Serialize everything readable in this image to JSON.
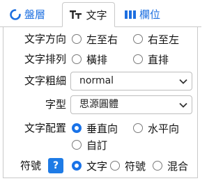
{
  "tabs": [
    {
      "label": "盤層",
      "icon": "circle-notch-icon",
      "active": false
    },
    {
      "label": "文字",
      "icon": "text-size-icon",
      "active": true
    },
    {
      "label": "欄位",
      "icon": "columns-icon",
      "active": false
    }
  ],
  "text_direction": {
    "label": "文字方向",
    "options": [
      "左至右",
      "右至左"
    ],
    "selected": null
  },
  "text_layout": {
    "label": "文字排列",
    "options": [
      "橫排",
      "直排"
    ],
    "selected": null
  },
  "font_weight": {
    "label": "文字粗細",
    "value": "normal"
  },
  "font_family": {
    "label": "字型",
    "value": "思源圓體"
  },
  "text_placement": {
    "label": "文字配置",
    "options": [
      "垂直向",
      "水平向",
      "自訂"
    ],
    "selected": "垂直向"
  },
  "symbol": {
    "label": "符號",
    "help": "?",
    "options": [
      "文字",
      "符號",
      "混合"
    ],
    "selected": "文字"
  },
  "colors": {
    "accent": "#1a73e8",
    "tab_active_text": "#222222",
    "border": "#c9c9c9"
  }
}
